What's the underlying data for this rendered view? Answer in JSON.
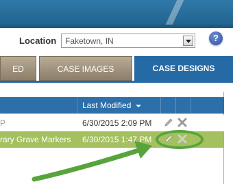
{
  "location": {
    "label": "Location",
    "selected": "Faketown, IN",
    "help_glyph": "?"
  },
  "tabs": [
    {
      "label": "ED",
      "active": false
    },
    {
      "label": "CASE IMAGES",
      "active": false
    },
    {
      "label": "CASE DESIGNS",
      "active": true
    }
  ],
  "table": {
    "columns": {
      "last_modified": "Last Modified"
    },
    "rows": [
      {
        "name": "P",
        "last_modified": "6/30/2015 2:09 PM",
        "highlighted": false
      },
      {
        "name": "rary Grave Markers",
        "last_modified": "6/30/2015 1:47 PM",
        "highlighted": true
      }
    ]
  },
  "colors": {
    "header_blue": "#2569a5",
    "selected_row_green": "#a4c05f",
    "annotation_green": "#57a43c"
  },
  "icons": [
    "edit-pencil-icon",
    "delete-x-icon",
    "help-icon",
    "dropdown-arrow-icon",
    "sort-desc-icon"
  ]
}
